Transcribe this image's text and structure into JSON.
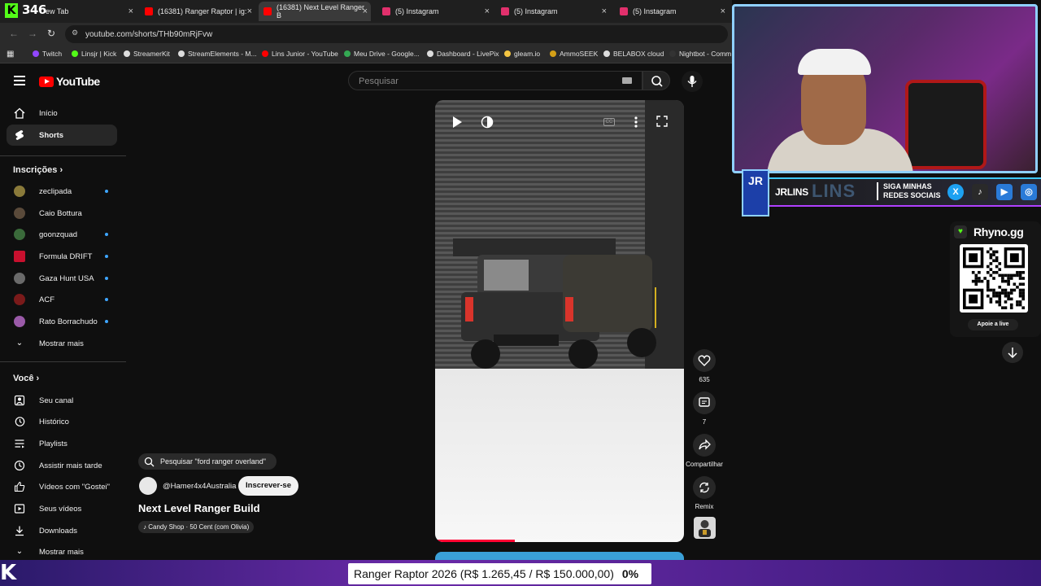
{
  "overlay": {
    "viewer_count": "346"
  },
  "browser": {
    "tabs": [
      {
        "title": "ew Tab",
        "color": "#888888"
      },
      {
        "title": "(16381) Ranger Raptor | ig:",
        "color": "#ff0000"
      },
      {
        "title": "(16381) Next Level Ranger B",
        "color": "#ff0000"
      },
      {
        "title": "(5) Instagram",
        "color": "#e1306c"
      },
      {
        "title": "(5) Instagram",
        "color": "#e1306c"
      },
      {
        "title": "(5) Instagram",
        "color": "#e1306c"
      }
    ],
    "url": "youtube.com/shorts/THb90mRjFvw",
    "bookmarks": [
      {
        "label": "Twitch",
        "color": "#9146ff"
      },
      {
        "label": "Linsjr | Kick",
        "color": "#53fc18"
      },
      {
        "label": "StreamerKit",
        "color": "#dddddd"
      },
      {
        "label": "StreamElements - M...",
        "color": "#dddddd"
      },
      {
        "label": "Lins Junior - YouTube",
        "color": "#ff0000"
      },
      {
        "label": "Meu Drive - Google...",
        "color": "#34a853"
      },
      {
        "label": "Dashboard - LivePix",
        "color": "#dddddd"
      },
      {
        "label": "gleam.io",
        "color": "#f4c542"
      },
      {
        "label": "AmmoSEEK",
        "color": "#d4a017"
      },
      {
        "label": "BELABOX cloud",
        "color": "#dddddd"
      },
      {
        "label": "Nightbot - Comm",
        "color": "#333333"
      }
    ]
  },
  "youtube": {
    "logo_text": "YouTube",
    "search_placeholder": "Pesquisar",
    "sidebar": {
      "main": [
        {
          "label": "Início",
          "icon": "home-icon"
        },
        {
          "label": "Shorts",
          "icon": "shorts-icon"
        }
      ],
      "subscriptions_heading": "Inscrições",
      "subscriptions": [
        {
          "label": "zeclipada",
          "color": "#8a7a3a",
          "dot": true
        },
        {
          "label": "Caio Bottura",
          "color": "#5a4a3a",
          "dot": false
        },
        {
          "label": "goonzquad",
          "color": "#3a6a3a",
          "dot": true
        },
        {
          "label": "Formula DRIFT",
          "color": "#c8102e",
          "dot": true
        },
        {
          "label": "Gaza Hunt USA",
          "color": "#6a6a6a",
          "dot": true
        },
        {
          "label": "ACF",
          "color": "#7a1a1a",
          "dot": true
        },
        {
          "label": "Rato Borrachudo",
          "color": "#9a5aa8",
          "dot": true
        }
      ],
      "show_more": "Mostrar mais",
      "you_heading": "Você",
      "you_items": [
        {
          "label": "Seu canal",
          "icon": "channel-icon"
        },
        {
          "label": "Histórico",
          "icon": "history-icon"
        },
        {
          "label": "Playlists",
          "icon": "playlists-icon"
        },
        {
          "label": "Assistir mais tarde",
          "icon": "watch-later-icon"
        },
        {
          "label": "Vídeos com \"Gostei\"",
          "icon": "like-icon"
        },
        {
          "label": "Seus vídeos",
          "icon": "your-videos-icon"
        },
        {
          "label": "Downloads",
          "icon": "download-icon"
        }
      ],
      "show_more_2": "Mostrar mais"
    },
    "short": {
      "search_chip": "Pesquisar \"ford ranger overland\"",
      "channel": "@Hamer4x4Australia",
      "subscribe": "Inscrever-se",
      "title": "Next Level Ranger Build",
      "sound": "Candy Shop · 50 Cent (com Olivia)",
      "progress": 0.32,
      "actions": {
        "likes": "635",
        "comments": "7",
        "share": "Compartilhar",
        "remix": "Remix"
      }
    }
  },
  "stream_overlay": {
    "badge": "JR",
    "name": "JRLINS",
    "ghost_name": "LINS",
    "follow": "SIGA MINHAS REDES SOCIAIS",
    "socials": [
      "X",
      "tiktok",
      "youtube",
      "instagram"
    ],
    "rhyno_title": "Rhyno.gg",
    "rhyno_button": "Apoie a live"
  },
  "goal_bar": {
    "text": "Ranger Raptor 2026 (R$ 1.265,45 / R$ 150.000,00)",
    "percent": "0%"
  }
}
